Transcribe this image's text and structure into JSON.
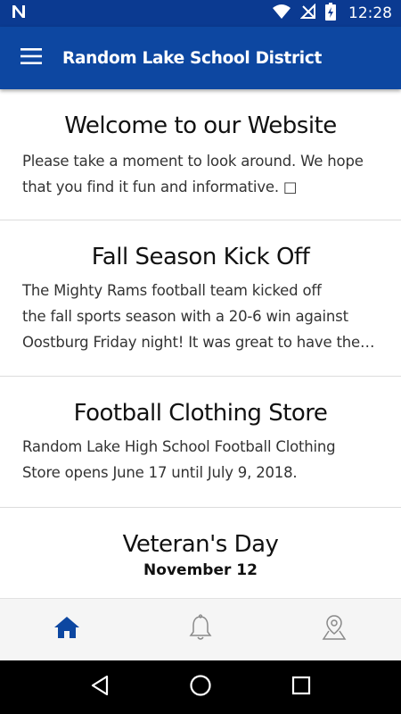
{
  "status_bar": {
    "time": "12:28",
    "icons": [
      "notification-n-icon",
      "wifi-icon",
      "no-signal-icon",
      "battery-charging-icon"
    ]
  },
  "app_bar": {
    "title": "Random Lake School District",
    "menu_icon": "hamburger-menu-icon"
  },
  "cards": [
    {
      "title": "Welcome to our Website",
      "body_lines": [
        "Please take a moment to look around. We hope",
        "that you find it fun and informative. □"
      ]
    },
    {
      "title": "Fall Season Kick Off",
      "body_lines": [
        "The Mighty Rams football team kicked off",
        "the fall sports season with a 20-6 win against",
        "Oostburg Friday night! It was great to have the …"
      ]
    },
    {
      "title": "Football Clothing Store",
      "body_lines": [
        "Random Lake High School Football Clothing",
        "Store opens June 17 until July 9, 2018."
      ]
    },
    {
      "title": "Veteran's Day",
      "date": "November 12"
    }
  ],
  "bottom_nav": {
    "items": [
      "home-icon",
      "bell-icon",
      "map-pin-icon"
    ],
    "active": "home-icon"
  },
  "system_nav": [
    "back-icon",
    "home-circle-icon",
    "recents-icon"
  ],
  "colors": {
    "status_bar": "#0b3a91",
    "app_bar": "#0d47a1",
    "active_nav_icon": "#0d47a1",
    "inactive_nav_icon": "#8a8a8a"
  }
}
